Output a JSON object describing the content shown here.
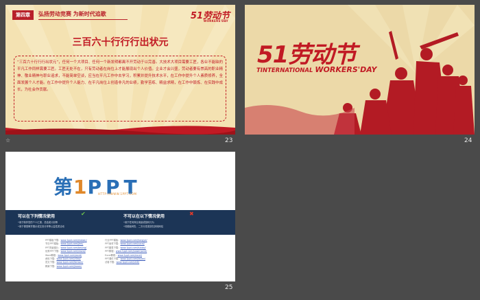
{
  "slides": [
    {
      "number": "23",
      "chapter": "第四章",
      "chapter_title": "弘扬劳动竞赛 为新时代追歌",
      "brand": "51劳动节",
      "brand_sub": "WORKERS'DAY",
      "title": "三百六十行行行出状元",
      "body": "“三百六十行行行出状元”，任何一个大项目、任何一个新发明都离不开劳动于以完善。大技术大项目需要工匠，各业不能缺的平凡工作同样需要工匠。工匠无处不在，只有劳动者在岗位上才能展现出个人价值。企业才会兴盛，劳动者要有崇高的职业精神、敬业精神与职业追求，不能简单空谈，应当在平凡工作中去学习，积累并提升技术水平，在工作中提升个人素质修养，全面发展个人才能。在工作中提升个人能力、在平凡岗位上创造非凡的业绩，勤学苦练、精益求精，在工作中锻炼、在实践中成长，为社会作贡献。"
    },
    {
      "number": "24",
      "big_title": "51劳动节",
      "subtitle_left": "TINTERNATIONAL",
      "subtitle_right": "WORKERS'DAY"
    },
    {
      "number": "25",
      "logo_part1": "第",
      "logo_part2": "1",
      "logo_part3": "PPT",
      "url": "HTTP://WWW.1PPT.COM",
      "can_use": "可以在下列情况使用",
      "cannot_use": "不可以在以下情况使用",
      "can_items": [
        "•用于制作您的个人汇报、总结或计划等",
        "•用于课堂教学展示或交流分享等公益性质活动"
      ],
      "cannot_items": [
        "•用于任何商业用途或营利行为",
        "•将模板转售、二次分发或放在其他网站"
      ],
      "links_left": [
        {
          "label": "PPT模板下载：",
          "url": "www.1ppt.com/moban/"
        },
        {
          "label": "节日PPT模板：",
          "url": "www.1ppt.com/jieri/"
        },
        {
          "label": "PPT背景图片：",
          "url": "www.1ppt.com/beijing/"
        },
        {
          "label": "优秀PPT下载：",
          "url": "www.1ppt.com/xiazai/"
        },
        {
          "label": "Word教程：",
          "url": "www.1ppt.com/word/"
        },
        {
          "label": "资料下载：",
          "url": "www.1ppt.com/ziliao/"
        },
        {
          "label": "范文下载：",
          "url": "www.1ppt.com/fanwen/"
        },
        {
          "label": "教案下载：",
          "url": "www.1ppt.com/jiaoan/"
        }
      ],
      "links_right": [
        {
          "label": "行业PPT模板：",
          "url": "www.1ppt.com/hangye/"
        },
        {
          "label": "PPT素材下载：",
          "url": "www.1ppt.com/sucai/"
        },
        {
          "label": "PPT图表下载：",
          "url": "www.1ppt.com/tubiao/"
        },
        {
          "label": "PPT教程：",
          "url": "www.1ppt.com/powerpoint/"
        },
        {
          "label": "Excel教程：",
          "url": "www.1ppt.com/excel/"
        },
        {
          "label": "PPT课件下载：",
          "url": "www.1ppt.com/kejian/"
        },
        {
          "label": "试卷下载：",
          "url": "www.1ppt.com/shiti/"
        }
      ]
    }
  ],
  "colors": {
    "background": "#4a4a4a",
    "accent_red": "#c11a24",
    "parchment": "#f4e2b2",
    "navy": "#1c3556"
  }
}
